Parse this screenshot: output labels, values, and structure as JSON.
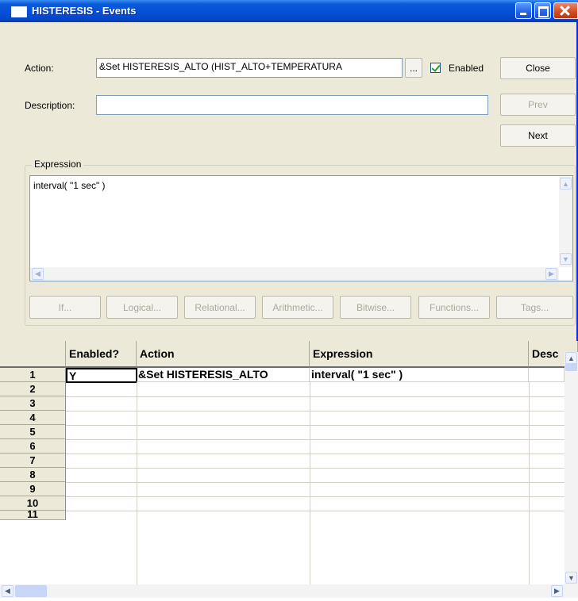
{
  "window": {
    "title": "HISTERESIS - Events"
  },
  "form": {
    "action_label": "Action:",
    "action_value": "&Set HISTERESIS_ALTO (HIST_ALTO+TEMPERATURA",
    "browse_label": "...",
    "enabled_label": "Enabled",
    "enabled_checked": true,
    "description_label": "Description:",
    "description_value": "",
    "close_label": "Close",
    "prev_label": "Prev",
    "next_label": "Next",
    "expression_group_label": "Expression",
    "expression_value": "interval( \"1 sec\" )"
  },
  "expression_buttons": [
    "If...",
    "Logical...",
    "Relational...",
    "Arithmetic...",
    "Bitwise...",
    "Functions...",
    "Tags..."
  ],
  "grid": {
    "columns": [
      "Enabled?",
      "Action",
      "Expression",
      "Desc"
    ],
    "row_numbers": [
      "1",
      "2",
      "3",
      "4",
      "5",
      "6",
      "7",
      "8",
      "9",
      "10",
      "11"
    ],
    "rows": [
      {
        "enabled": "Y",
        "action": "&Set HISTERESIS_ALTO",
        "expression": "interval( \"1 sec\" )"
      }
    ]
  },
  "colors": {
    "title_bar": "#0450d8",
    "window_face": "#ece9d8",
    "field_border": "#7f9db9"
  }
}
